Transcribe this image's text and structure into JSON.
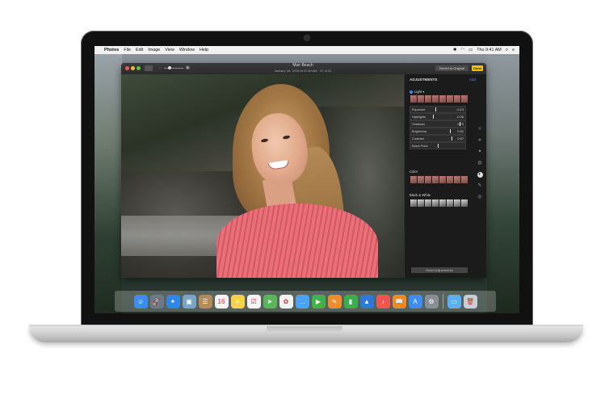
{
  "menubar": {
    "apple_icon": "apple-icon",
    "app": "Photos",
    "items": [
      "File",
      "Edit",
      "Image",
      "View",
      "Window",
      "Help"
    ],
    "clock": "Thu 9:41 AM"
  },
  "window": {
    "title": "Muir Beach",
    "subtitle": "January 16, 2015 at 11:49 AM  ·  37 of 61",
    "revert_label": "Revert to Original",
    "done_label": "Done"
  },
  "panel": {
    "title": "ADJUSTMENTS",
    "add_label": "Add",
    "light_label": "Light",
    "sliders": [
      {
        "label": "Exposure",
        "value": "-0.13",
        "level": 0.46
      },
      {
        "label": "Highlights",
        "value": "-0.26",
        "level": 0.42
      },
      {
        "label": "Shadows",
        "value": "0.70",
        "level": 0.9
      },
      {
        "label": "Brightness",
        "value": "0.51",
        "level": 0.72
      },
      {
        "label": "Contrast",
        "value": "0.57",
        "level": 0.75
      },
      {
        "label": "Black Point",
        "value": "",
        "level": 0.5
      }
    ],
    "color_label": "Color",
    "bw_label": "Black & White",
    "reset_label": "Reset Adjustments"
  },
  "tools": [
    "adjust-icon",
    "crop-icon",
    "filters-icon",
    "retouch-icon",
    "adjustments-icon",
    "red-eye-icon",
    "effects-icon"
  ],
  "dock": [
    {
      "name": "finder-icon",
      "color": "#3a8ef0",
      "glyph": "☺"
    },
    {
      "name": "launchpad-icon",
      "color": "#6d7a8a",
      "glyph": "🚀"
    },
    {
      "name": "safari-icon",
      "color": "#2f86e8",
      "glyph": "✦"
    },
    {
      "name": "photo-gallery-icon",
      "color": "#7aa7c8",
      "glyph": "▣"
    },
    {
      "name": "contacts-icon",
      "color": "#b48b5a",
      "glyph": "☰"
    },
    {
      "name": "calendar-icon",
      "color": "#f4f4f4",
      "glyph": "16"
    },
    {
      "name": "notes-icon",
      "color": "#f6d24a",
      "glyph": "≡"
    },
    {
      "name": "reminders-icon",
      "color": "#f4f4f4",
      "glyph": "☑"
    },
    {
      "name": "maps-icon",
      "color": "#5bb55b",
      "glyph": "➤"
    },
    {
      "name": "photos-icon",
      "color": "#f2f2f2",
      "glyph": "✿"
    },
    {
      "name": "messages-icon",
      "color": "#4aa3f5",
      "glyph": "…"
    },
    {
      "name": "facetime-icon",
      "color": "#3fb24a",
      "glyph": "▶"
    },
    {
      "name": "pages-icon",
      "color": "#f08c2a",
      "glyph": "✎"
    },
    {
      "name": "numbers-icon",
      "color": "#37b04b",
      "glyph": "▮"
    },
    {
      "name": "keynote-icon",
      "color": "#2d78d8",
      "glyph": "▲"
    },
    {
      "name": "music-icon",
      "color": "#f2554f",
      "glyph": "♪"
    },
    {
      "name": "ibooks-icon",
      "color": "#f28a1e",
      "glyph": "📖"
    },
    {
      "name": "app-store-icon",
      "color": "#3b8ef5",
      "glyph": "A"
    },
    {
      "name": "system-preferences-icon",
      "color": "#8a8f95",
      "glyph": "⚙"
    },
    {
      "name": "sep",
      "color": "",
      "glyph": ""
    },
    {
      "name": "downloads-folder-icon",
      "color": "#5ab0f0",
      "glyph": "▭"
    },
    {
      "name": "trash-icon",
      "color": "#c8ced4",
      "glyph": "🗑"
    }
  ],
  "colors": {
    "accent": "#3b8ef5",
    "done_button": "#f2c200"
  }
}
